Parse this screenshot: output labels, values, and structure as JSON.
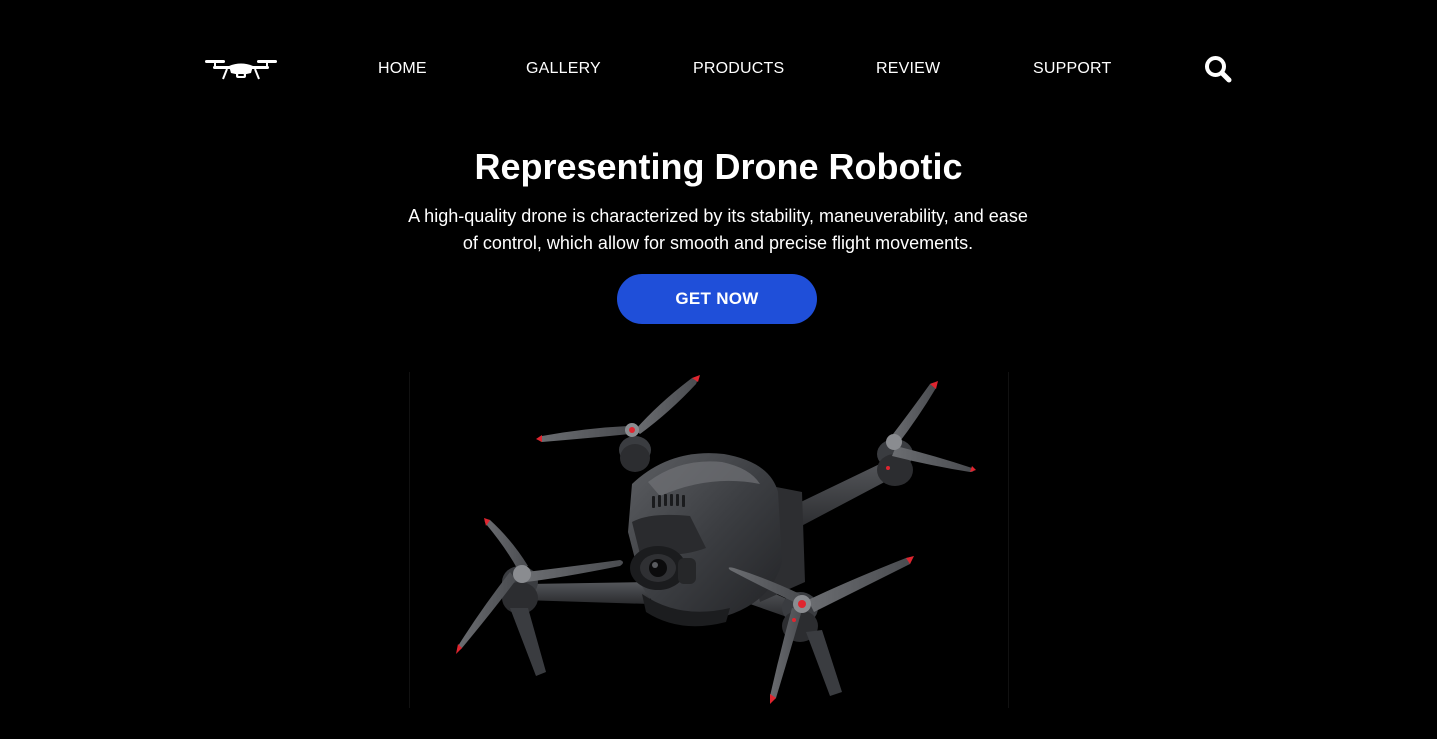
{
  "header": {
    "logo_icon": "drone-logo-icon",
    "nav": [
      {
        "label": "HOME"
      },
      {
        "label": "GALLERY"
      },
      {
        "label": "PRODUCTS"
      },
      {
        "label": "REVIEW"
      },
      {
        "label": "SUPPORT"
      }
    ],
    "search_icon": "search-icon"
  },
  "hero": {
    "title": "Representing Drone Robotic",
    "description_line1": "A high-quality drone is characterized by its stability, maneuverability, and ease",
    "description_line2": "of control, which allow for smooth and precise flight movements.",
    "cta_label": "GET NOW"
  },
  "colors": {
    "background": "#000000",
    "text": "#ffffff",
    "accent": "#1f4fd9",
    "propeller_tip": "#e0252f"
  },
  "product_image": {
    "subject": "fpv-drone-photo"
  }
}
